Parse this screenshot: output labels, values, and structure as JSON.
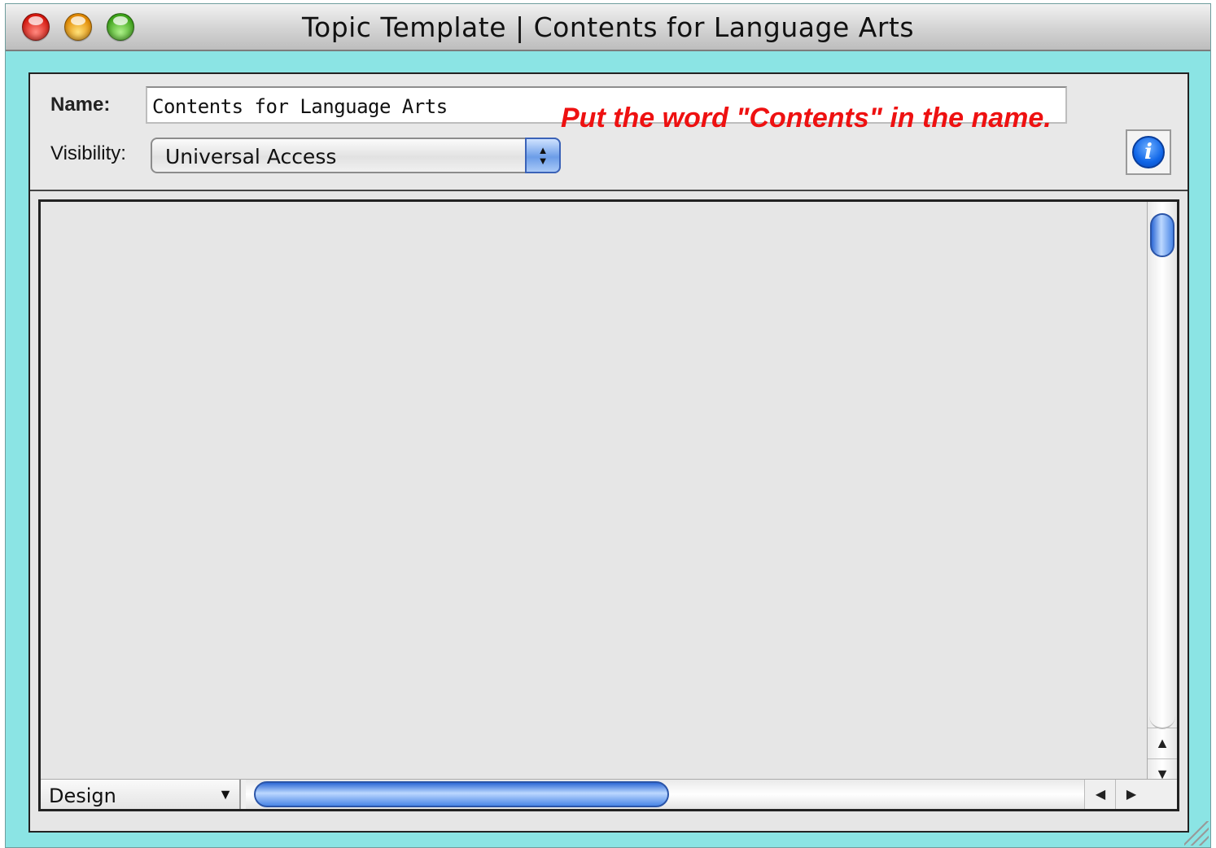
{
  "window": {
    "title": "Topic Template | Contents for Language Arts"
  },
  "form": {
    "name_label": "Name:",
    "name_value": "Contents for Language Arts",
    "annotation": "Put the word \"Contents\" in the name.",
    "visibility_label": "Visibility:",
    "visibility_value": "Universal Access",
    "info_icon": "i"
  },
  "editor": {
    "mode_value": "Design",
    "icons": {
      "close": "close-button",
      "minimize": "minimize-button",
      "zoom": "zoom-button",
      "info": "info-icon",
      "scroll_up": "arrow-up-icon",
      "scroll_down": "arrow-down-icon",
      "scroll_left": "arrow-left-icon",
      "scroll_right": "arrow-right-icon",
      "resize": "resize-grip-icon"
    }
  },
  "colors": {
    "window_frame": "#8be4e4",
    "annotation": "#ee1111",
    "accent": "#1066e8"
  }
}
